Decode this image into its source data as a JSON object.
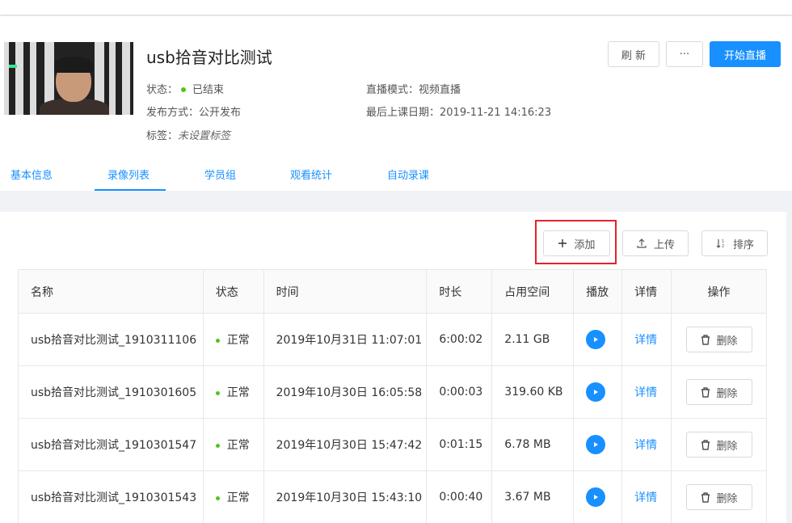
{
  "course": {
    "title": "usb拾音对比测试",
    "status_label": "状态：",
    "status_value": "已结束",
    "publish_label": "发布方式：",
    "publish_value": "公开发布",
    "tags_label": "标签：",
    "tags_value": "未设置标签",
    "mode_label": "直播模式：",
    "mode_value": "视频直播",
    "last_date_label": "最后上课日期：",
    "last_date_value": "2019-11-21 14:16:23",
    "status_color": "#52c41a"
  },
  "actions": {
    "refresh": "刷 新",
    "more": "···",
    "start_live": "开始直播"
  },
  "tabs": [
    "基本信息",
    "录像列表",
    "学员组",
    "观看统计",
    "自动录课"
  ],
  "toolbar": {
    "add": "添加",
    "upload": "上传",
    "sort": "排序"
  },
  "table": {
    "headers": [
      "名称",
      "状态",
      "时间",
      "时长",
      "占用空间",
      "播放",
      "详情",
      "操作"
    ],
    "rows": [
      {
        "name": "usb拾音对比测试_1910311106",
        "status": "正常",
        "time": "2019年10月31日 11:07:01",
        "duration": "6:00:02",
        "size": "2.11 GB",
        "detail": "详情",
        "delete": "删除"
      },
      {
        "name": "usb拾音对比测试_1910301605",
        "status": "正常",
        "time": "2019年10月30日 16:05:58",
        "duration": "0:00:03",
        "size": "319.60 KB",
        "detail": "详情",
        "delete": "删除"
      },
      {
        "name": "usb拾音对比测试_1910301547",
        "status": "正常",
        "time": "2019年10月30日 15:47:42",
        "duration": "0:01:15",
        "size": "6.78 MB",
        "detail": "详情",
        "delete": "删除"
      },
      {
        "name": "usb拾音对比测试_1910301543",
        "status": "正常",
        "time": "2019年10月30日 15:43:10",
        "duration": "0:00:40",
        "size": "3.67 MB",
        "detail": "详情",
        "delete": "删除"
      }
    ]
  },
  "colors": {
    "accent": "#1890ff",
    "highlight_box": "#e0242c"
  }
}
